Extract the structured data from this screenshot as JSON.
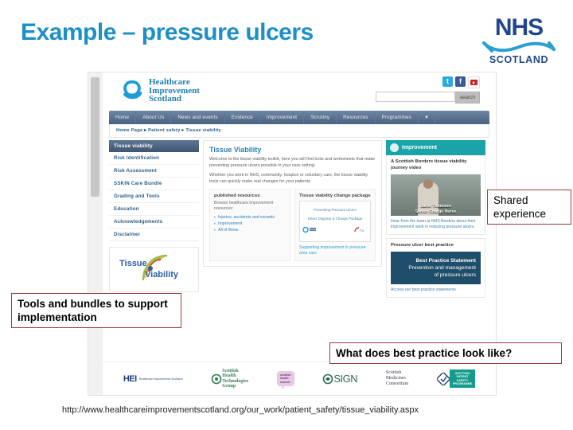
{
  "slide": {
    "title": "Example – pressure ulcers",
    "title_color": "#1c8fc6",
    "url": "http://www.healthcareimprovementscotland.org/our_work/patient_safety/tissue_viability.aspx"
  },
  "nhs_logo": {
    "letters": "NHS",
    "subtitle": "SCOTLAND",
    "color": "#20478b"
  },
  "callouts": {
    "shared_experience": "Shared experience",
    "tools_bundles": "Tools and bundles to support implementation",
    "best_practice": "What does best practice look like?",
    "border_color": "#9b3b3b"
  },
  "website": {
    "brand": {
      "line1": "Healthcare",
      "line2": "Improvement",
      "line3": "Scotland",
      "color": "#1e7fb0"
    },
    "social": [
      {
        "name": "twitter-icon",
        "glyph": "t"
      },
      {
        "name": "facebook-icon",
        "glyph": "f"
      },
      {
        "name": "youtube-icon",
        "glyph": ""
      }
    ],
    "search": {
      "placeholder": "",
      "value": "",
      "button_label": "search"
    },
    "nav": [
      {
        "label": "Home"
      },
      {
        "label": "About Us"
      },
      {
        "label": "News and events"
      },
      {
        "label": "Evidence"
      },
      {
        "label": "Improvement"
      },
      {
        "label": "Scrutiny"
      },
      {
        "label": "Resources"
      },
      {
        "label": "Programmes"
      },
      {
        "label": "▼"
      }
    ],
    "breadcrumb": "Home Page  ▸  Patient safety  ▸  Tissue viability",
    "sidebar": {
      "header": "Tissue viability",
      "items": [
        {
          "label": "Risk Identification"
        },
        {
          "label": "Risk Assessment"
        },
        {
          "label": "SSKIN Care Bundle"
        },
        {
          "label": "Grading and Tools"
        },
        {
          "label": "Education"
        },
        {
          "label": "Acknowledgements"
        },
        {
          "label": "Disclaimer"
        }
      ],
      "logo": {
        "word1": "Tissue",
        "word2": "Viability"
      }
    },
    "main": {
      "heading": "Tissue Viability",
      "paragraph1": "Welcome to the tissue viability toolkit, here you will find tools and worksheets that make preventing pressure ulcers possible in your care setting.",
      "paragraph2": "Whether you work in NHS, community, hospice or voluntary care, the tissue viability tools can quickly make real changes for your patients.",
      "resources_card": {
        "heading": "published resources",
        "text": "Browse healthcare improvement resources:",
        "links": [
          {
            "label": "Injuries, accidents and wounds"
          },
          {
            "label": "Improvement"
          },
          {
            "label": "All of these"
          }
        ]
      },
      "change_package_card": {
        "heading": "Tissue viability change package",
        "doc_line1": "Preventing Pressure Ulcers",
        "doc_line2": "Driver Diagram & Change Package",
        "caption": "Supporting improvement in pressure area care"
      }
    },
    "right": {
      "improvement_header": "Improvement",
      "video_card": {
        "heading": "A Scottish Borders tissue viability journey video",
        "speaker_name": "Janie Thomson",
        "speaker_role": "Senior Charge Nurse",
        "caption": "Hear from the team at NHS Borders about their improvement work in reducing pressure ulcers."
      },
      "best_practice_card": {
        "heading": "Pressure ulcer best practice",
        "box_line1": "Best Practice Statement",
        "box_line2": "Prevention and management",
        "box_line3": "of pressure ulcers",
        "caption": "Access our best practice statements"
      }
    },
    "footer_logos": [
      {
        "name": "hei-logo",
        "main": "HEI",
        "sub": "Healthcare Improvement Scotland"
      },
      {
        "name": "shtg-logo",
        "line1": "Scottish",
        "line2": "Health",
        "line3": "Technologies",
        "line4": "Group"
      },
      {
        "name": "scottish-health-council-logo",
        "line1": "scottish",
        "line2": "health",
        "line3": "council"
      },
      {
        "name": "sign-logo",
        "label": "SIGN"
      },
      {
        "name": "smc-logo",
        "line1": "Scottish",
        "line2": "Medicines",
        "line3": "Consortium"
      },
      {
        "name": "spsp-logo",
        "line1": "SCOTTISH",
        "line2": "PATIENT",
        "line3": "SAFETY",
        "line4": "PROGRAMME"
      }
    ]
  }
}
